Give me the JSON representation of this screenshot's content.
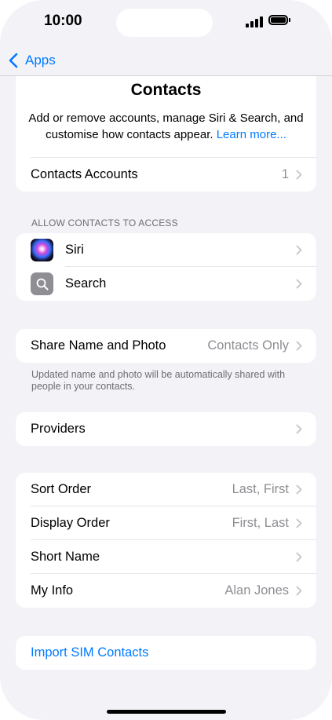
{
  "status_bar": {
    "time": "10:00"
  },
  "nav": {
    "back_label": "Apps"
  },
  "header": {
    "title": "Contacts",
    "description": "Add or remove accounts, manage Siri & Search, and customise how contacts appear.",
    "link": "Learn more..."
  },
  "accounts": {
    "label": "Contacts Accounts",
    "value": "1"
  },
  "access": {
    "section_title": "ALLOW CONTACTS TO ACCESS",
    "items": [
      {
        "label": "Siri",
        "icon": "siri-icon"
      },
      {
        "label": "Search",
        "icon": "search-icon"
      }
    ]
  },
  "share": {
    "label": "Share Name and Photo",
    "value": "Contacts Only",
    "footer": "Updated name and photo will be automatically shared with people in your contacts."
  },
  "providers": {
    "label": "Providers"
  },
  "display": {
    "items": [
      {
        "label": "Sort Order",
        "value": "Last, First"
      },
      {
        "label": "Display Order",
        "value": "First, Last"
      },
      {
        "label": "Short Name",
        "value": ""
      },
      {
        "label": "My Info",
        "value": "Alan Jones"
      }
    ]
  },
  "sim": {
    "label": "Import SIM Contacts"
  },
  "colors": {
    "accent": "#007aff",
    "background": "#f2f2f7",
    "secondary_text": "#8e8e93"
  }
}
